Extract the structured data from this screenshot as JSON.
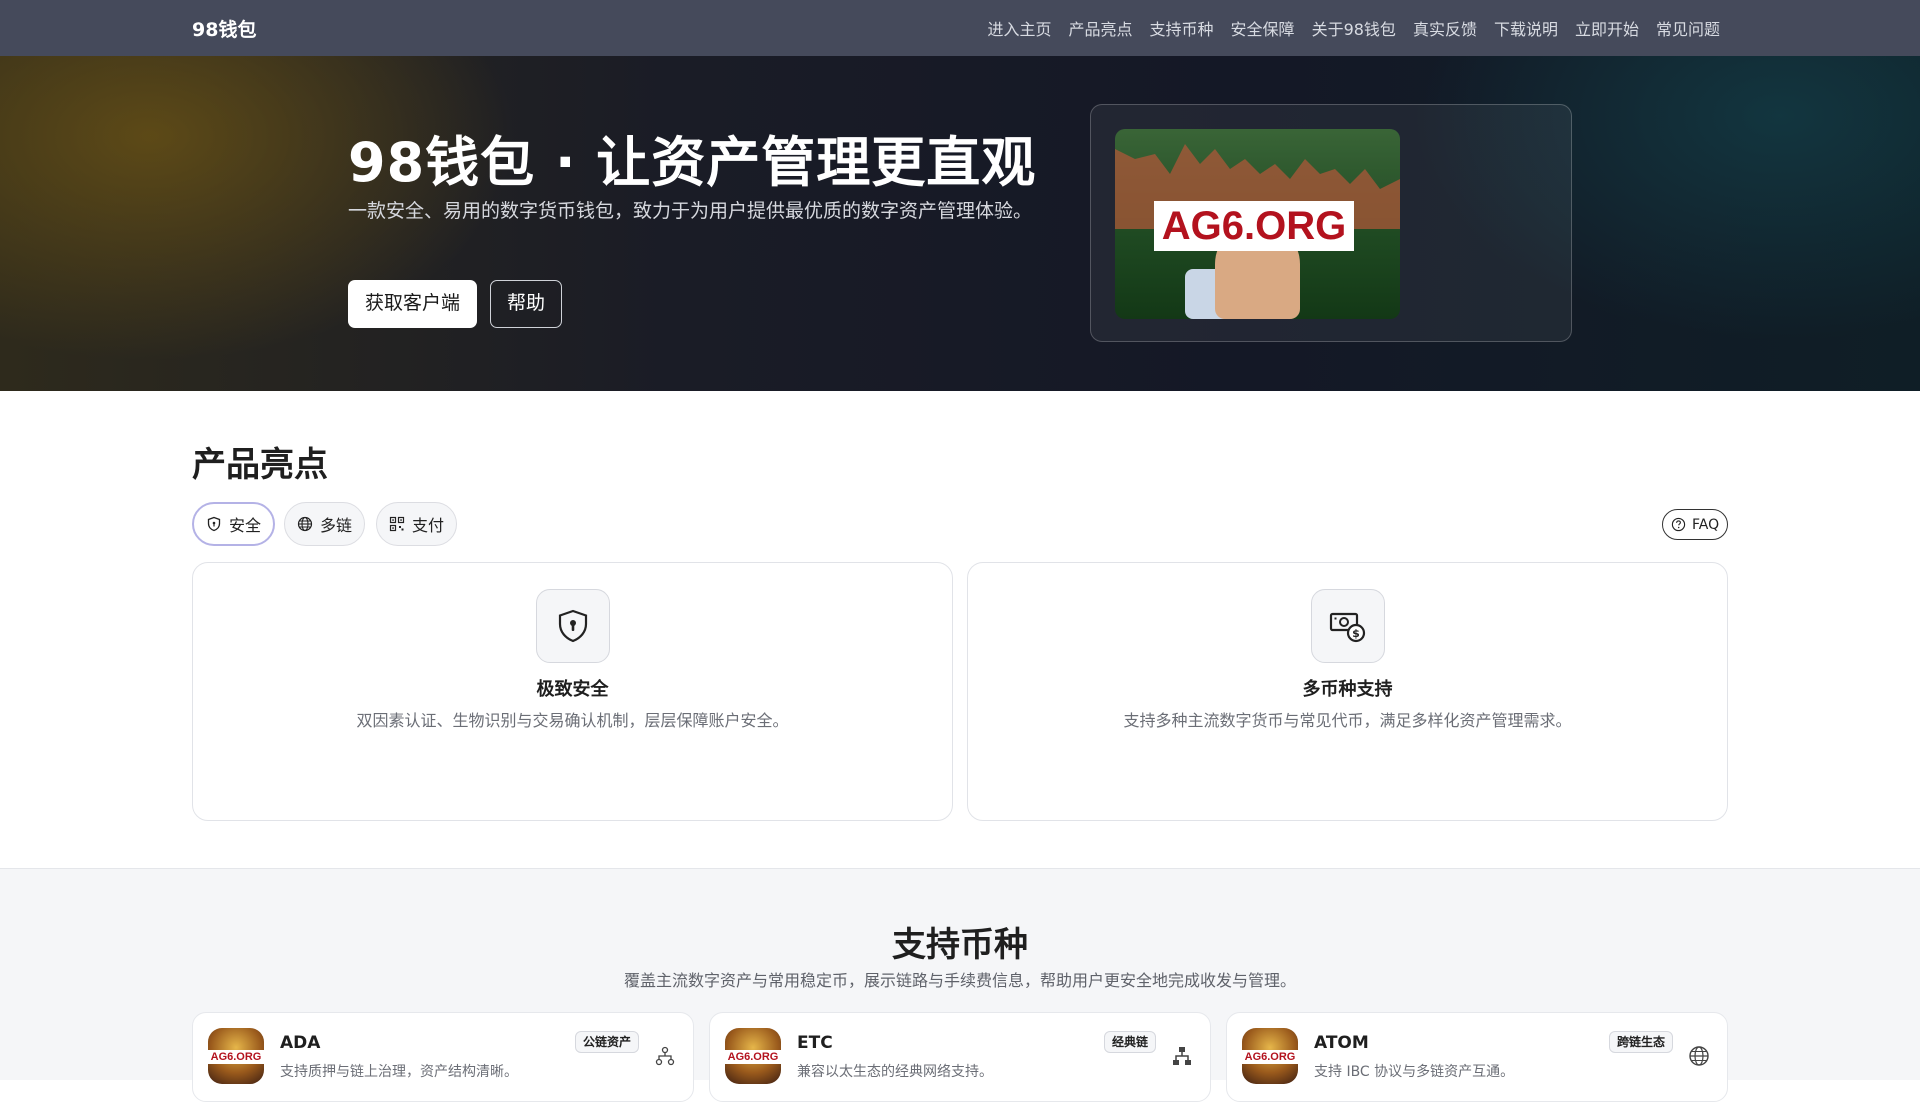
{
  "nav": {
    "brand": "98钱包",
    "links": [
      "进入主页",
      "产品亮点",
      "支持币种",
      "安全保障",
      "关于98钱包",
      "真实反馈",
      "下载说明",
      "立即开始",
      "常见问题"
    ]
  },
  "hero": {
    "title": "98钱包 · 让资产管理更直观",
    "subtitle": "一款安全、易用的数字货币钱包，致力于为用户提供最优质的数字资产管理体验。",
    "primary_button": "获取客户端",
    "secondary_button": "帮助",
    "image_logo_text": "AG6.ORG"
  },
  "features": {
    "title": "产品亮点",
    "tabs": [
      {
        "label": "安全",
        "icon": "shield-icon",
        "active": true
      },
      {
        "label": "多链",
        "icon": "globe-icon",
        "active": false
      },
      {
        "label": "支付",
        "icon": "qr-icon",
        "active": false
      }
    ],
    "faq_label": "FAQ",
    "cards": [
      {
        "icon": "shield-lock-icon",
        "title": "极致安全",
        "desc": "双因素认证、生物识别与交易确认机制，层层保障账户安全。"
      },
      {
        "icon": "cash-coin-icon",
        "title": "多币种支持",
        "desc": "支持多种主流数字货币与常见代币，满足多样化资产管理需求。"
      }
    ]
  },
  "coins": {
    "title": "支持币种",
    "subtitle": "覆盖主流数字资产与常用稳定币，展示链路与手续费信息，帮助用户更安全地完成收发与管理。",
    "logo_text": "AG6.ORG",
    "items": [
      {
        "name": "ADA",
        "desc": "支持质押与链上治理，资产结构清晰。",
        "badge": "公链资产",
        "icon": "diagram-icon"
      },
      {
        "name": "ETC",
        "desc": "兼容以太生态的经典网络支持。",
        "badge": "经典链",
        "icon": "network-icon"
      },
      {
        "name": "ATOM",
        "desc": "支持 IBC 协议与多链资产互通。",
        "badge": "跨链生态",
        "icon": "globe-icon"
      }
    ]
  },
  "colors": {
    "nav_bg": "#454a5b",
    "logo_red": "#b3121e",
    "active_chip_border": "#b4b2e6"
  }
}
